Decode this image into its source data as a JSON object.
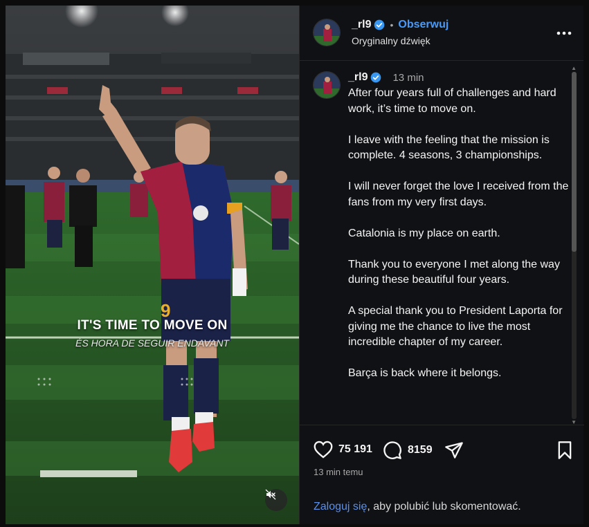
{
  "header": {
    "username": "_rl9",
    "separator": "•",
    "follow_label": "Obserwuj",
    "audio_label": "Oryginalny dźwięk"
  },
  "media": {
    "caption_main": "IT'S TIME TO MOVE ON",
    "caption_sub": "ÉS HORA DE SEGUIR ENDAVANT",
    "shirt_number": "9",
    "mute_icon": "speaker-muted-icon"
  },
  "post": {
    "username": "_rl9",
    "time_ago": "13 min",
    "paragraphs": [
      "After four years full of challenges and hard work, it’s time to move on.",
      "I leave with the feeling that the mission is complete. 4 seasons, 3 championships.",
      "I will never forget the love I received from the fans from my very first days.",
      "Catalonia is my place on earth.",
      "Thank you to everyone I met along the way during these beautiful four years.",
      "A special thank you to President Laporta for giving me the chance to live the most incredible chapter of my career.",
      "Barça is back where it belongs."
    ]
  },
  "actions": {
    "likes": "75 191",
    "comments": "8159",
    "post_time": "13 min temu"
  },
  "footer": {
    "login_link": "Zaloguj się",
    "login_rest": ", aby polubić lub skomentować."
  },
  "colors": {
    "accent": "#4a9bf7",
    "link": "#5c8fe8",
    "background": "#101114",
    "verified": "#3897f0"
  }
}
